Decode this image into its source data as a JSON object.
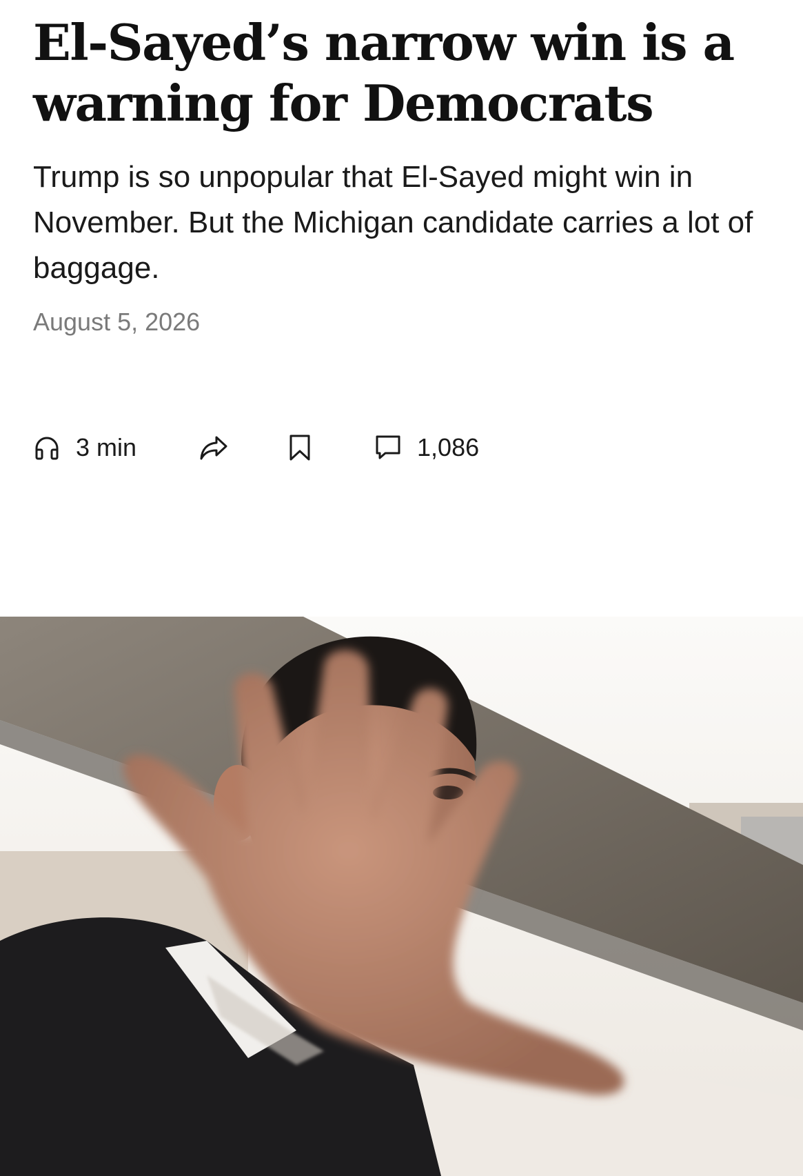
{
  "article": {
    "headline": "El-Sayed’s narrow win is a warning for Democrats",
    "dek": "Trump is so unpopular that El-Sayed might win in November. But the Michigan candidate carries a lot of baggage.",
    "date": "August 5, 2026"
  },
  "toolbar": {
    "listen_label": "3 min",
    "comment_count": "1,086",
    "icons": {
      "listen": "headphones-icon",
      "share": "share-arrow-icon",
      "save": "bookmark-icon",
      "comments": "comment-bubble-icon"
    }
  },
  "colors": {
    "text": "#111111",
    "muted": "#7a7a7a",
    "background": "#ffffff"
  }
}
